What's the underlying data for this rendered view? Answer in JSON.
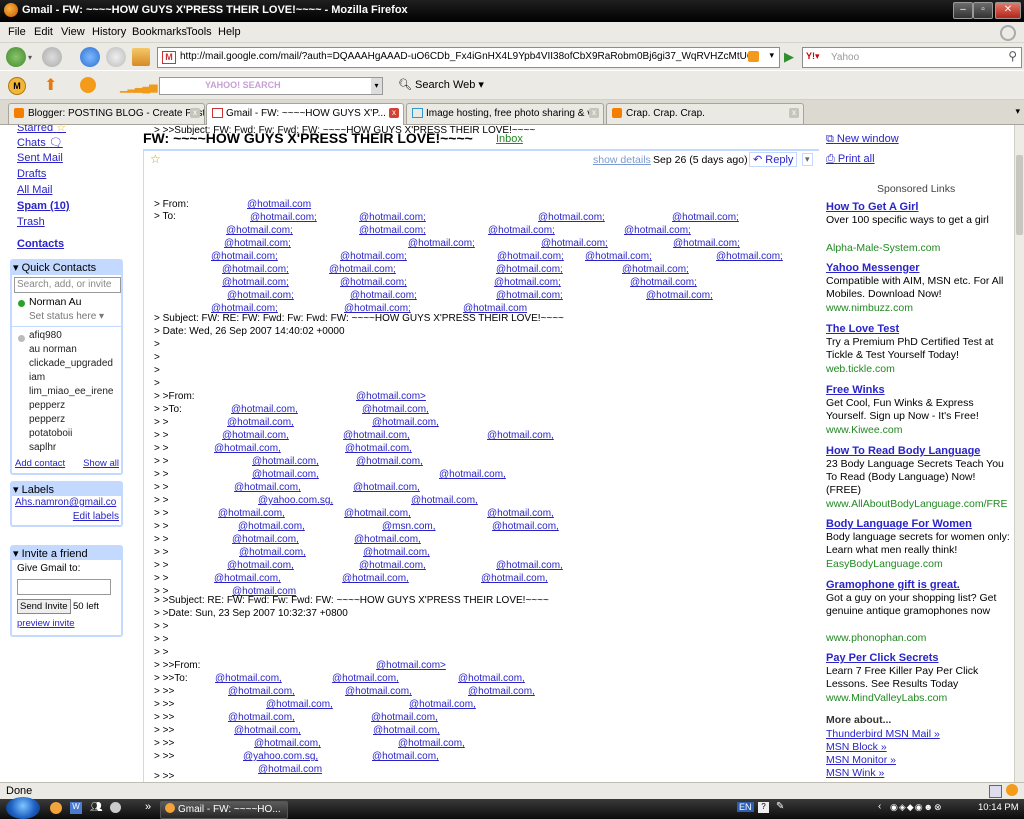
{
  "window": {
    "title": "Gmail - FW: ~~~~HOW GUYS X'PRESS THEIR LOVE!~~~~ - Mozilla Firefox"
  },
  "menu": [
    "File",
    "Edit",
    "View",
    "History",
    "Bookmarks",
    "Tools",
    "Help"
  ],
  "url": "http://mail.google.com/mail/?auth=DQAAAHgAAAD-uO6CDb_Fx4iGnHX4L9Ypb4VII38ofCbX9RaRobm0Bj6gi37_WqRVHZcMtU6pT-uY_2rgQpCFvJFnr",
  "search_placeholder": "Yahoo",
  "yahoo_toolbar": {
    "search_placeholder": "YAHOO! SEARCH",
    "search_web": "Search Web"
  },
  "tabs": [
    {
      "label": "Blogger: POSTING BLOG - Create Post",
      "active": false
    },
    {
      "label": "Gmail - FW: ~~~~HOW GUYS X'P...",
      "active": true
    },
    {
      "label": "Image hosting, free photo sharing & v...",
      "active": false
    },
    {
      "label": "Crap. Crap. Crap.",
      "active": false
    }
  ],
  "nav": {
    "items": [
      "Starred",
      "Chats",
      "Sent Mail",
      "Drafts",
      "All Mail",
      "Spam (10)",
      "Trash"
    ],
    "contacts": "Contacts"
  },
  "quick_contacts": {
    "title": "Quick Contacts",
    "search_placeholder": "Search, add, or invite",
    "me": "Norman Au",
    "status": "Set status here",
    "list": [
      "afiq980",
      "au norman",
      "clickade_upgraded",
      "iam",
      "lim_miao_ee_irene",
      "pepperz",
      "pepperz",
      "potatoboii",
      "saplhr"
    ],
    "add": "Add contact",
    "show_all": "Show all"
  },
  "labels": {
    "title": "Labels",
    "item": "Ahs.namron@gmail.co",
    "edit": "Edit labels"
  },
  "invite": {
    "title": "Invite a friend",
    "prompt": "Give Gmail to:",
    "button": "Send Invite",
    "left": "50 left",
    "preview": "preview invite"
  },
  "message": {
    "subject": "FW: ~~~~HOW GUYS X'PRESS THEIR LOVE!~~~~",
    "label": "Inbox",
    "show_details": "show details",
    "date": "Sep 26 (5 days ago)",
    "reply": "Reply",
    "lines": [
      "> From:",
      "> To:",
      "> Subject: FW: RE: FW: Fwd: Fw: Fwd: FW: ~~~~HOW GUYS X'PRESS THEIR LOVE!~~~~",
      "> Date: Wed, 26 Sep 2007 14:40:02 +0000",
      ">",
      ">",
      ">",
      ">",
      "> >From:",
      "> >To:",
      "> >",
      "> >",
      "> >",
      "> >",
      "> >",
      "> >",
      "> >",
      "> >",
      "> >",
      "> >",
      "> >",
      "> >",
      "> >",
      "> >",
      "> >Subject: RE: FW: Fwd: Fw: Fwd: FW: ~~~~HOW GUYS X'PRESS THEIR LOVE!~~~~",
      "> >Date: Sun, 23 Sep 2007 10:32:37 +0800",
      "> >",
      "> >",
      "> >",
      "> >>From:",
      "> >>To:",
      "> >>",
      "> >>",
      "> >>",
      "> >>",
      "> >>",
      "> >>",
      "> >>",
      "> >>Subject: FW: Fwd: Fw: Fwd: FW: ~~~~HOW GUYS X'PRESS THEIR LOVE!~~~~"
    ],
    "email_hotmail": "@hotmail.com",
    "email_hotmail_comma": "@hotmail.com;",
    "email_hotmail_c": "@hotmail.com,",
    "email_hotmail_gt": "@hotmail.com>",
    "email_yahoo": "@yahoo.com.sg,",
    "email_msn": "@msn.com,"
  },
  "right": {
    "new_window": "New window",
    "print_all": "Print all",
    "sponsored": "Sponsored Links",
    "ads": [
      {
        "title": "How To Get A Girl",
        "desc": "Over 100 specific ways to get a girl",
        "url": "Alpha-Male-System.com"
      },
      {
        "title": "Yahoo Messenger",
        "desc": "Compatible with AIM, MSN etc. For All Mobiles. Download Now!",
        "url": "www.nimbuzz.com"
      },
      {
        "title": "The Love Test",
        "desc": "Try a Premium PhD Certified Test at Tickle & Test Yourself Today!",
        "url": "web.tickle.com"
      },
      {
        "title": "Free Winks",
        "desc": "Get Cool, Fun Winks & Express Yourself. Sign up Now - It's Free!",
        "url": "www.Kiwee.com"
      },
      {
        "title": "How To Read Body Language",
        "desc": "23 Body Language Secrets Teach You To Read (Body Language) Now! (FREE)",
        "url": "www.AllAboutBodyLanguage.com/FRE"
      },
      {
        "title": "Body Language For Women",
        "desc": "Body language secrets for women only: Learn what men really think!",
        "url": "EasyBodyLanguage.com"
      },
      {
        "title": "Gramophone gift is great.",
        "desc": "Got a guy on your shopping list? Get genuine antique gramophones now",
        "url": "www.phonophan.com"
      },
      {
        "title": "Pay Per Click Secrets",
        "desc": "Learn 7 Free Killer Pay Per Click Lessons. See Results Today",
        "url": "www.MindValleyLabs.com"
      }
    ],
    "more_about": "More about...",
    "more": [
      "Thunderbird MSN Mail »",
      "MSN Block »",
      "MSN Monitor »",
      "MSN Wink »"
    ]
  },
  "status": "Done",
  "taskbar": {
    "item": "Gmail - FW: ~~~~HO...",
    "lang": "EN",
    "clock": "10:14 PM"
  }
}
